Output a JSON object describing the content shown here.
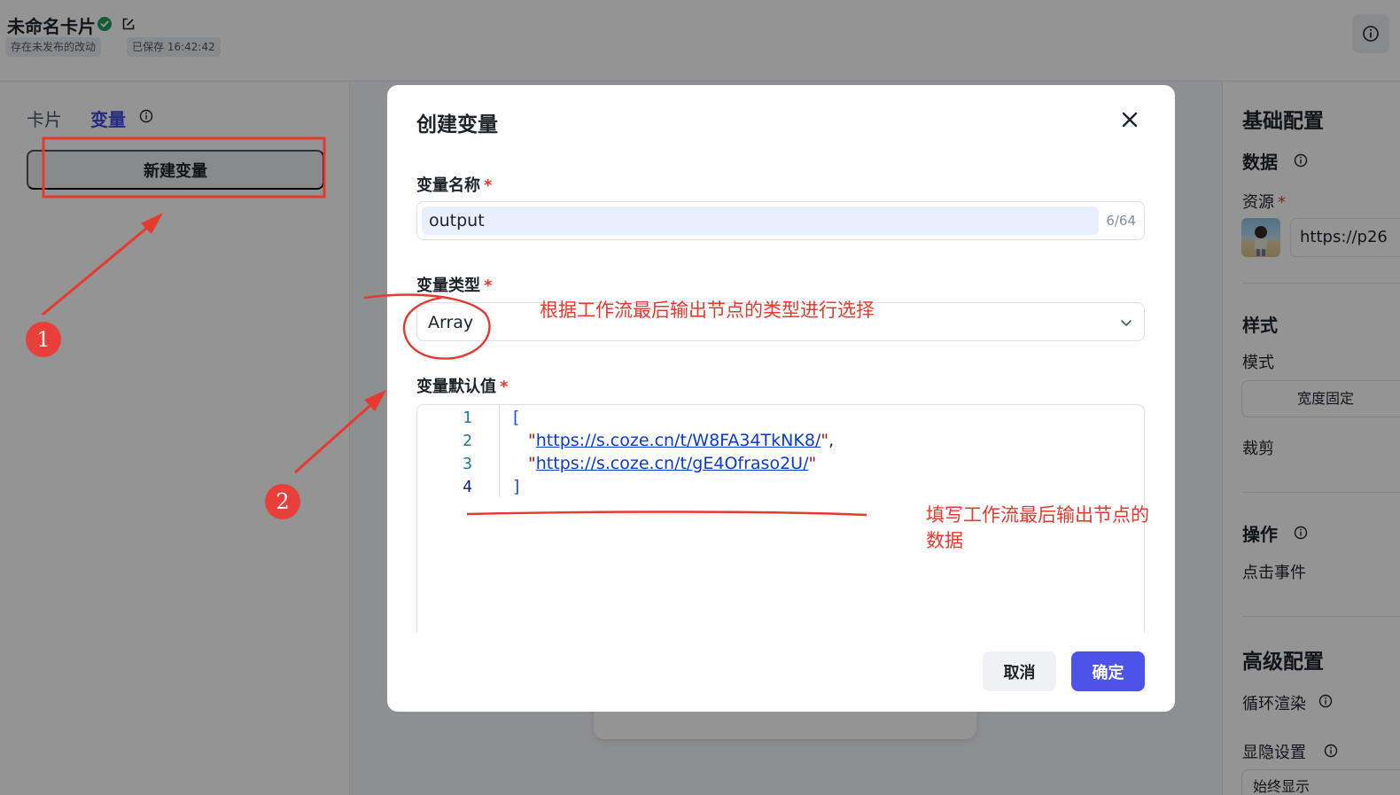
{
  "header": {
    "title": "未命名卡片",
    "status_tag": "存在未发布的改动",
    "saved_tag": "已保存 16:42:42"
  },
  "left_panel": {
    "tabs": [
      {
        "label": "卡片"
      },
      {
        "label": "变量"
      }
    ],
    "new_variable_button": "新建变量"
  },
  "right_panel": {
    "basic_config": "基础配置",
    "data": "数据",
    "resource": "资源",
    "resource_url": "https://p26",
    "style": "样式",
    "mode": "模式",
    "width_fixed": "宽度固定",
    "crop": "裁剪",
    "operation": "操作",
    "click_event": "点击事件",
    "advanced_config": "高级配置",
    "loop_render": "循环渲染",
    "visibility": "显隐设置",
    "visibility_value": "始终显示"
  },
  "modal": {
    "title": "创建变量",
    "name_label": "变量名称",
    "name_value": "output",
    "name_count": "6/64",
    "type_label": "变量类型",
    "type_value": "Array",
    "default_label": "变量默认值",
    "required_mark": "*",
    "code": {
      "line_numbers": [
        "1",
        "2",
        "3",
        "4"
      ],
      "open_bracket": "[",
      "url1": "https://s.coze.cn/t/W8FA34TkNK8/",
      "url2": "https://s.coze.cn/t/gE4Ofraso2U/",
      "close_bracket": "]"
    },
    "cancel": "取消",
    "confirm": "确定"
  },
  "annotations": {
    "badge1": "1",
    "badge2": "2",
    "type_note": "根据工作流最后输出节点的类型进行选择",
    "data_note_line1": "填写工作流最后输出节点的",
    "data_note_line2": "数据",
    "accent_color": "#e6392f"
  }
}
